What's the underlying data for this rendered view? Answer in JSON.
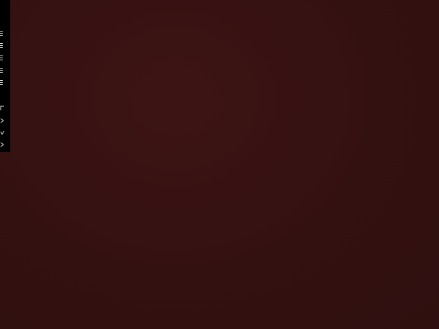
{
  "desktop": {
    "background_color": "#361212"
  },
  "side_toolbar": {
    "background_color": "#000000",
    "icon_color": "#e8e8e8",
    "icons": [
      "menu-icon",
      "menu-icon",
      "menu-icon",
      "menu-icon",
      "menu-icon",
      "corner-icon",
      "arrow-icon",
      "arrow-icon",
      "arrow-icon"
    ]
  }
}
